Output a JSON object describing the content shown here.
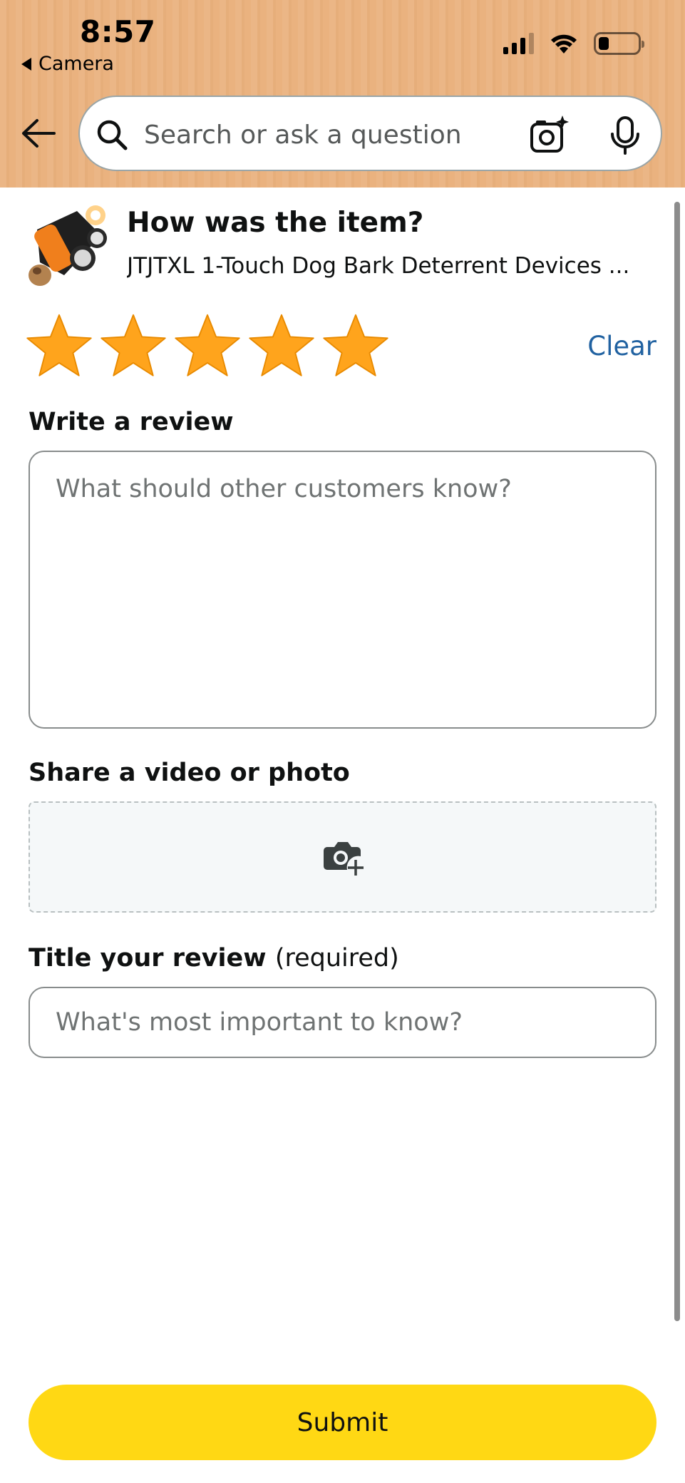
{
  "status_bar": {
    "time": "8:57",
    "back_app_label": "Camera"
  },
  "search": {
    "placeholder": "Search or ask a question"
  },
  "icons": {
    "back": "back-arrow-icon",
    "search": "search-icon",
    "camera": "camera-sparkle-icon",
    "mic": "microphone-icon",
    "add_media": "camera-plus-icon"
  },
  "review": {
    "heading": "How was the item?",
    "product_name": "JTJTXL 1-Touch Dog Bark Deterrent Devices ...",
    "rating": 5,
    "max_rating": 5,
    "clear_label": "Clear",
    "write_label": "Write a review",
    "write_placeholder": "What should other customers know?",
    "media_label": "Share a video or photo",
    "title_label": "Title your review",
    "title_required": "(required)",
    "title_placeholder": "What's most important to know?",
    "submit_label": "Submit"
  },
  "colors": {
    "header_bg": "#eab27f",
    "star_fill": "#ffa41c",
    "link": "#2162a1",
    "submit_bg": "#ffd814"
  }
}
